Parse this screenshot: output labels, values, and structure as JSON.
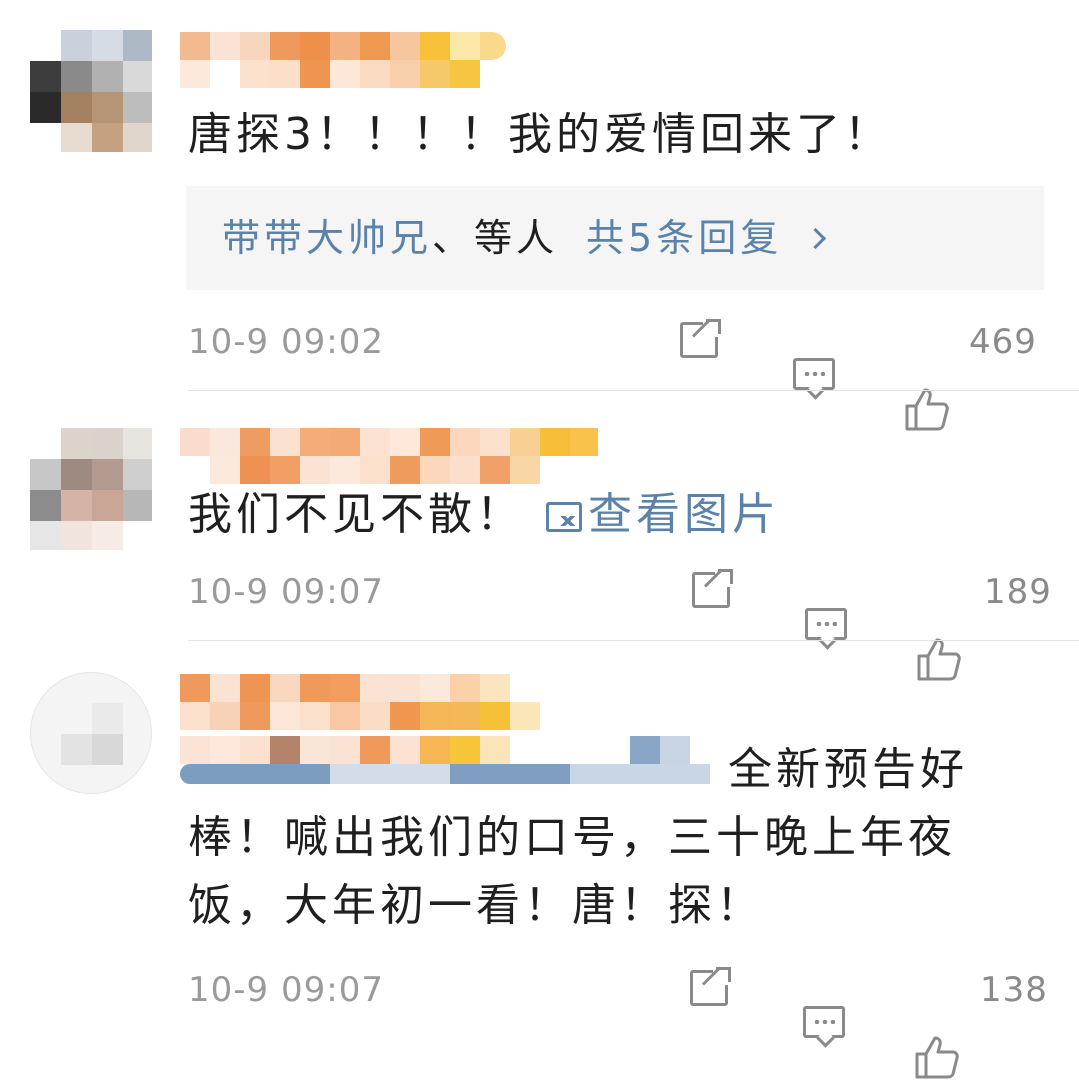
{
  "comments": [
    {
      "text": "唐探3！！！！我的爱情回来了！",
      "reply_preview": {
        "users": "带带大帅兄",
        "separator": "、等人",
        "count_label": "共5条回复"
      },
      "time": "10-9 09:02",
      "likes": "469"
    },
    {
      "text": "我们不见不散！",
      "image_link": "查看图片",
      "time": "10-9 09:07",
      "likes": "189"
    },
    {
      "text": "全新预告好棒！喊出我们的口号，三十晚上年夜饭，大年初一看！唐！探！",
      "time": "10-9 09:07",
      "likes": "138"
    }
  ],
  "icons": {
    "share": "share-icon",
    "comment": "comment-icon",
    "like": "thumbs-up-icon",
    "image": "image-icon",
    "chevron": "chevron-right-icon"
  },
  "colors": {
    "link": "#5b82a8",
    "meta": "#9a9a9a",
    "icon": "#8a8a8a",
    "reply_bg": "#f5f5f5"
  }
}
